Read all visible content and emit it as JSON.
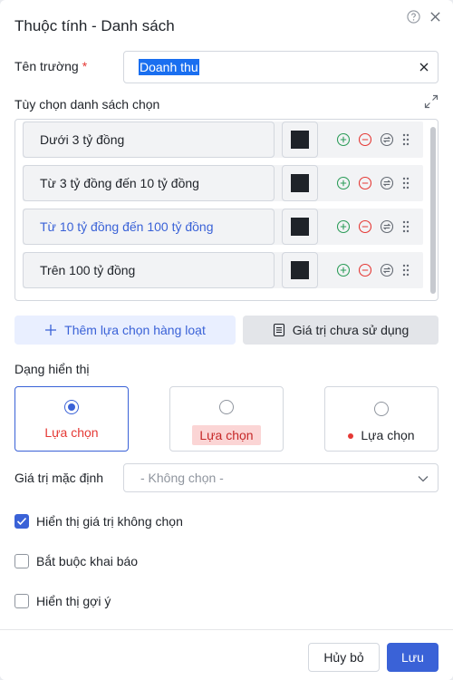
{
  "dialog": {
    "title": "Thuộc tính - Danh sách"
  },
  "field_name": {
    "label": "Tên trường",
    "required_mark": "*",
    "value": "Doanh thu"
  },
  "options_section": {
    "label": "Tùy chọn danh sách chọn",
    "items": [
      {
        "label": "Dưới 3 tỷ đồng",
        "color": "#1f2329",
        "active": false
      },
      {
        "label": "Từ 3 tỷ đồng đến 10 tỷ đồng",
        "color": "#1f2329",
        "active": false
      },
      {
        "label": "Từ 10 tỷ đồng đến 100 tỷ đồng",
        "color": "#1f2329",
        "active": true
      },
      {
        "label": "Trên 100 tỷ đồng",
        "color": "#1f2329",
        "active": false
      }
    ]
  },
  "buttons": {
    "bulk_add": "Thêm lựa chọn hàng loạt",
    "unused_values": "Giá trị chưa sử dụng",
    "cancel": "Hủy bỏ",
    "save": "Lưu"
  },
  "display_type": {
    "label": "Dạng hiển thị",
    "options": [
      {
        "text": "Lựa chọn",
        "style": "text",
        "selected": true
      },
      {
        "text": "Lựa chọn",
        "style": "tag",
        "selected": false
      },
      {
        "text": "Lựa chọn",
        "style": "dot",
        "selected": false
      }
    ]
  },
  "default_value": {
    "label": "Giá trị mặc định",
    "placeholder": "- Không chọn -"
  },
  "checkboxes": [
    {
      "label": "Hiển thị giá trị không chọn",
      "checked": true
    },
    {
      "label": "Bắt buộc khai báo",
      "checked": false
    },
    {
      "label": "Hiển thị gợi ý",
      "checked": false
    }
  ],
  "colors": {
    "primary": "#3a62d7",
    "danger": "#e53935",
    "add_green": "#2e9d5a"
  }
}
